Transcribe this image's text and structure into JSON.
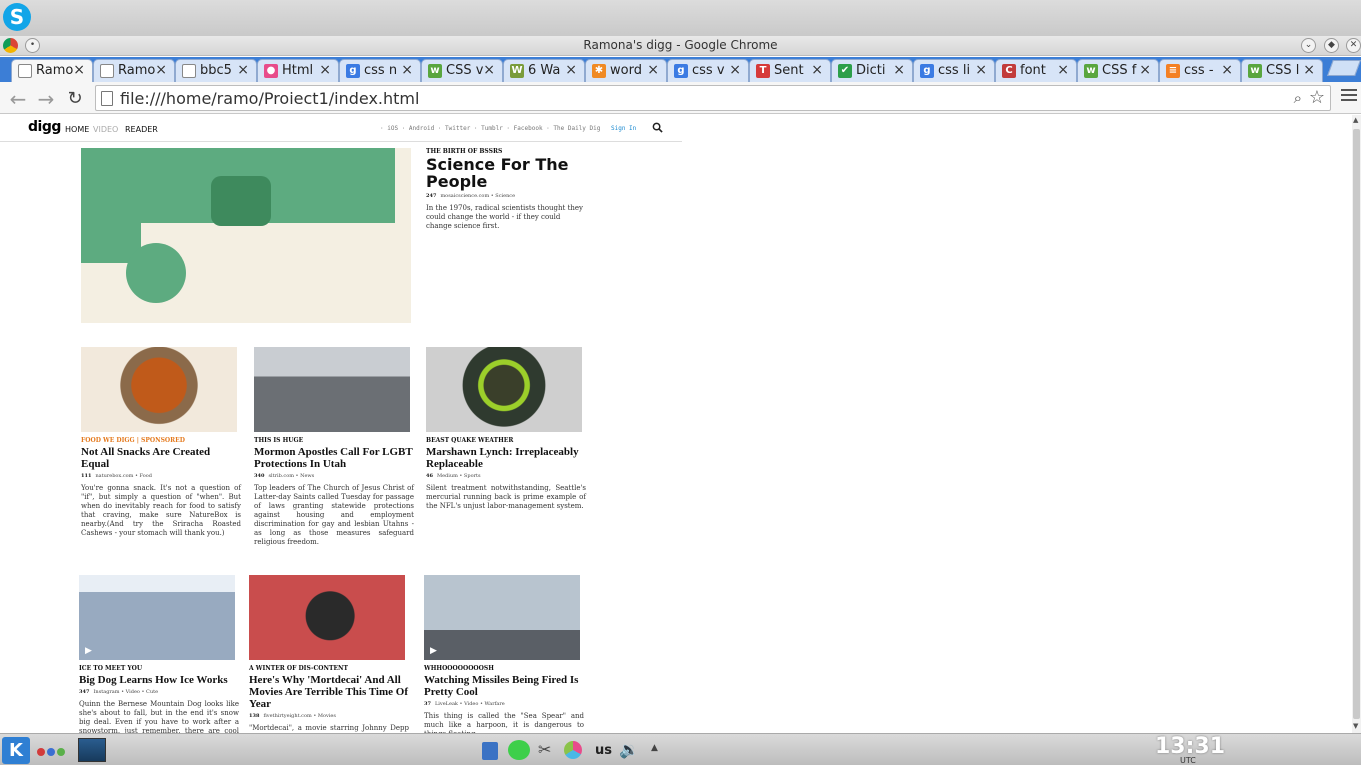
{
  "window": {
    "title": "Ramona's digg - Google Chrome"
  },
  "tabs": [
    {
      "label": "Ramo",
      "favicon": "page-icon",
      "color": "#f6f6f6"
    },
    {
      "label": "Ramo",
      "favicon": "page-icon",
      "color": "#d7e4f7"
    },
    {
      "label": "bbc5",
      "favicon": "page-icon",
      "color": "#d7e4f7"
    },
    {
      "label": "Html",
      "favicon": "color-wheel-icon",
      "color": "#d7e4f7"
    },
    {
      "label": "css n",
      "favicon": "google-icon",
      "color": "#d7e4f7"
    },
    {
      "label": "CSS v",
      "favicon": "w3schools-icon",
      "color": "#d7e4f7"
    },
    {
      "label": "6 Wa",
      "favicon": "wikihow-icon",
      "color": "#d7e4f7"
    },
    {
      "label": "word",
      "favicon": "asterisk-icon",
      "color": "#d7e4f7"
    },
    {
      "label": "css v",
      "favicon": "google-icon",
      "color": "#d7e4f7"
    },
    {
      "label": "Sent",
      "favicon": "tatoeba-icon",
      "color": "#d7e4f7"
    },
    {
      "label": "Dicti",
      "favicon": "check-icon",
      "color": "#d7e4f7"
    },
    {
      "label": "css li",
      "favicon": "google-icon",
      "color": "#d7e4f7"
    },
    {
      "label": "font",
      "favicon": "csstricks-icon",
      "color": "#d7e4f7"
    },
    {
      "label": "CSS f",
      "favicon": "w3schools-icon",
      "color": "#d7e4f7"
    },
    {
      "label": "css -",
      "favicon": "stackoverflow-icon",
      "color": "#d7e4f7"
    },
    {
      "label": "CSS l",
      "favicon": "w3schools-icon",
      "color": "#d7e4f7"
    }
  ],
  "toolbar": {
    "url": "file:///home/ramo/Proiect1/index.html"
  },
  "digg": {
    "logo": "digg",
    "nav": {
      "home": "HOME",
      "video": "VIDEO",
      "reader": "READER"
    },
    "links": "· iOS · Android · Twitter · Tumblr · Facebook · The Daily Dig",
    "signin": "Sign In",
    "hero": {
      "kicker": "THE BIRTH OF BSSRS",
      "title": "Science For The People",
      "count": "247",
      "source": "mosaicscience.com • Science",
      "desc": "In the 1970s, radical scientists thought they could change the world - if they could change science first."
    },
    "row1": [
      {
        "kicker": "FOOD WE DIGG | SPONSORED",
        "kicker_orange": true,
        "title": "Not All Snacks Are Created Equal",
        "count": "111",
        "source": "naturebox.com  •  Food",
        "desc": "You're gonna snack. It's not a question of \"if\", but simply a question of \"when\". But when do inevitably reach for food to satisfy that craving, make sure NatureBox is nearby.(And try the Sriracha Roasted Cashews - your stomach will thank you.)",
        "img": "snacks"
      },
      {
        "kicker": "THIS IS HUGE",
        "kicker_orange": false,
        "title": "Mormon Apostles Call For LGBT Protections In Utah",
        "count": "340",
        "source": "sltrib.com  •  News",
        "desc": "Top leaders of The Church of Jesus Christ of Latter-day Saints called Tuesday for passage of laws granting statewide protections against housing and employment discrimination for gay and lesbian Utahns - as long as those measures safeguard religious freedom.",
        "img": "temple"
      },
      {
        "kicker": "BEAST QUAKE WEATHER",
        "kicker_orange": false,
        "title": "Marshawn Lynch: Irreplaceably Replaceable",
        "count": "46",
        "source": "Medium  •  Sports",
        "desc": "Silent treatment notwithstanding, Seattle's mercurial running back is prime example of the NFL's unjust labor-management system.",
        "img": "lynch"
      }
    ],
    "row2": [
      {
        "kicker": "ICE TO MEET YOU",
        "title": "Big Dog Learns How Ice Works",
        "count": "347",
        "source": "Instagram • Video • Cute",
        "desc": "Quinn the Bernese Mountain Dog looks like she's about to fall, but in the end it's snow big deal. Even if you have to work after a snowstorm, just remember, there are cool dogs enjoying",
        "img": "dog"
      },
      {
        "kicker": "A WINTER OF DIS-CONTENT",
        "title": "Here's Why 'Mortdecai' And All Movies Are Terrible This Time Of Year",
        "count": "138",
        "source": "fivethirtyeight.com • Movies",
        "desc": "\"Mortdecai\", a movie starring Johnny Depp that",
        "img": "depp"
      },
      {
        "kicker": "WHHOOOOOOOOSH",
        "title": "Watching Missiles Being Fired Is Pretty Cool",
        "count": "37",
        "source": "LiveLeak  •  Video •  Warfare",
        "desc": "This thing is called the \"Sea Spear\" and much like a harpoon, it is dangerous to things floating",
        "img": "missile"
      }
    ]
  },
  "taskbar": {
    "clock": "13:31",
    "tz": "UTC",
    "layout": "us"
  }
}
